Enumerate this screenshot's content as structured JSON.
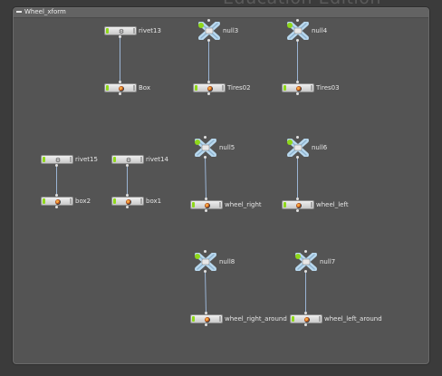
{
  "watermark": "Education Edition",
  "network_box": {
    "title": "Wheel_xform",
    "collapse_icon": "minus-icon"
  },
  "nodes": {
    "rivet13": {
      "label": "rivet13",
      "type": "rivet",
      "icon": "rivet-icon"
    },
    "box_obj": {
      "label": "Box",
      "type": "geo",
      "icon": "geo-object-icon"
    },
    "null3": {
      "label": "null3",
      "type": "null",
      "icon": "null-icon"
    },
    "tires02": {
      "label": "Tires02",
      "type": "geo",
      "icon": "geo-object-icon"
    },
    "null4": {
      "label": "null4",
      "type": "null",
      "icon": "null-icon"
    },
    "tires03": {
      "label": "Tires03",
      "type": "geo",
      "icon": "geo-object-icon"
    },
    "rivet15": {
      "label": "rivet15",
      "type": "rivet",
      "icon": "rivet-icon"
    },
    "box2": {
      "label": "box2",
      "type": "geo",
      "icon": "geo-object-icon"
    },
    "rivet14": {
      "label": "rivet14",
      "type": "rivet",
      "icon": "rivet-icon"
    },
    "box1": {
      "label": "box1",
      "type": "geo",
      "icon": "geo-object-icon"
    },
    "null5": {
      "label": "null5",
      "type": "null",
      "icon": "null-icon"
    },
    "wheel_right": {
      "label": "wheel_right",
      "type": "geo",
      "icon": "geo-object-icon"
    },
    "null6": {
      "label": "null6",
      "type": "null",
      "icon": "null-icon"
    },
    "wheel_left": {
      "label": "wheel_left",
      "type": "geo",
      "icon": "geo-object-icon"
    },
    "null8": {
      "label": "null8",
      "type": "null",
      "icon": "null-icon"
    },
    "wheel_right_around": {
      "label": "wheel_right_around",
      "type": "geo",
      "icon": "geo-object-icon"
    },
    "null7": {
      "label": "null7",
      "type": "null",
      "icon": "null-icon"
    },
    "wheel_left_around": {
      "label": "wheel_left_around",
      "type": "geo",
      "icon": "geo-object-icon"
    }
  },
  "connections": [
    [
      "rivet13",
      "box_obj"
    ],
    [
      "null3",
      "tires02"
    ],
    [
      "null4",
      "tires03"
    ],
    [
      "rivet15",
      "box2"
    ],
    [
      "rivet14",
      "box1"
    ],
    [
      "null5",
      "wheel_right"
    ],
    [
      "null6",
      "wheel_left"
    ],
    [
      "null8",
      "wheel_right_around"
    ],
    [
      "null7",
      "wheel_left_around"
    ]
  ],
  "colors": {
    "background": "#3b3b3b",
    "network_box": "#545454",
    "display_flag": "#8fd81a",
    "null_node": "#b9d9ef",
    "wire": "#9ab4d4"
  }
}
